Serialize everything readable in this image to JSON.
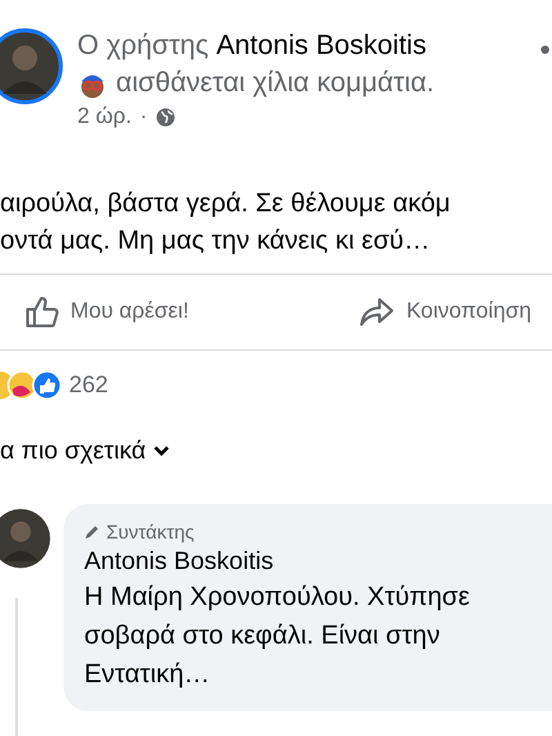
{
  "post": {
    "prefix": "Ο χρήστης",
    "author": "Antonis Boskoitis",
    "feeling": "αισθάνεται χίλια κομμάτια.",
    "time": "2 ώρ.",
    "separator": "·",
    "text_lines": [
      "αιρούλα, βάστα γερά. Σε θέλουμε ακόμ",
      "οντά μας. Μη μας την κάνεις κι εσύ…"
    ]
  },
  "actions": [
    {
      "kind": "like",
      "label": "Μου αρέσει!"
    },
    {
      "kind": "share",
      "label": "Κοινοποίηση"
    }
  ],
  "reactions": {
    "count": "262"
  },
  "sort": {
    "label": "α πιο σχετικά"
  },
  "comment": {
    "badge": "Συντάκτης",
    "author": "Antonis Boskoitis",
    "text": "Η Μαίρη Χρονοπούλου. Χτύπησε σοβαρά στο κεφάλι. Είναι στην Εντατική…"
  }
}
